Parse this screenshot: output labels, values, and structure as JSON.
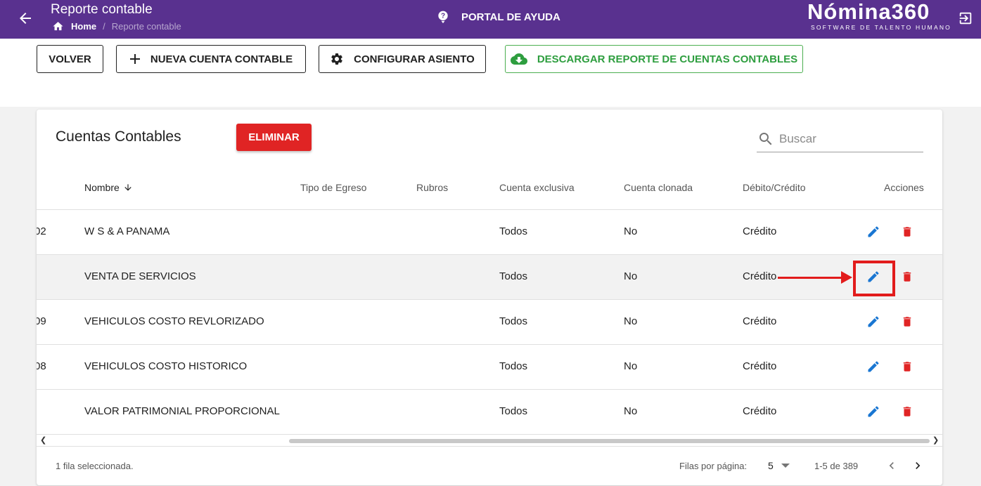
{
  "header": {
    "title": "Reporte contable",
    "breadcrumb_home": "Home",
    "breadcrumb_sep": "/",
    "breadcrumb_current": "Reporte contable",
    "help_label": "PORTAL DE AYUDA",
    "logo_main": "Nómina360",
    "logo_sub": "SOFTWARE DE TALENTO HUMANO",
    "bg_color": "#59318f"
  },
  "toolbar": {
    "volver": "VOLVER",
    "nueva": "NUEVA CUENTA CONTABLE",
    "configurar": "CONFIGURAR ASIENTO",
    "descargar": "DESCARGAR REPORTE DE CUENTAS CONTABLES"
  },
  "card": {
    "title": "Cuentas Contables",
    "delete_button": "ELIMINAR",
    "search_placeholder": "Buscar"
  },
  "table": {
    "columns": {
      "nombre": "Nombre",
      "tipo_egreso": "Tipo de Egreso",
      "rubros": "Rubros",
      "cuenta_exclusiva": "Cuenta exclusiva",
      "cuenta_clonada": "Cuenta clonada",
      "debito_credito": "Débito/Crédito",
      "acciones": "Acciones"
    },
    "rows": [
      {
        "code": "02",
        "nombre": "W S & A PANAMA",
        "exclusiva": "Todos",
        "clonada": "No",
        "debcred": "Crédito"
      },
      {
        "code": "",
        "nombre": "VENTA DE SERVICIOS",
        "exclusiva": "Todos",
        "clonada": "No",
        "debcred": "Crédito"
      },
      {
        "code": "09",
        "nombre": "VEHICULOS COSTO REVLORIZADO",
        "exclusiva": "Todos",
        "clonada": "No",
        "debcred": "Crédito"
      },
      {
        "code": "08",
        "nombre": "VEHICULOS COSTO HISTORICO",
        "exclusiva": "Todos",
        "clonada": "No",
        "debcred": "Crédito"
      },
      {
        "code": "",
        "nombre": "VALOR PATRIMONIAL PROPORCIONAL",
        "exclusiva": "Todos",
        "clonada": "No",
        "debcred": "Crédito"
      }
    ]
  },
  "footer": {
    "selected": "1 fila seleccionada.",
    "rows_per_page_label": "Filas por página:",
    "rows_per_page": "5",
    "range": "1-5 de 389"
  },
  "colors": {
    "edit_icon": "#1976d2",
    "delete_icon": "#e02424",
    "download_green": "#2e9e3f",
    "annotation_red": "#e21c1c"
  }
}
